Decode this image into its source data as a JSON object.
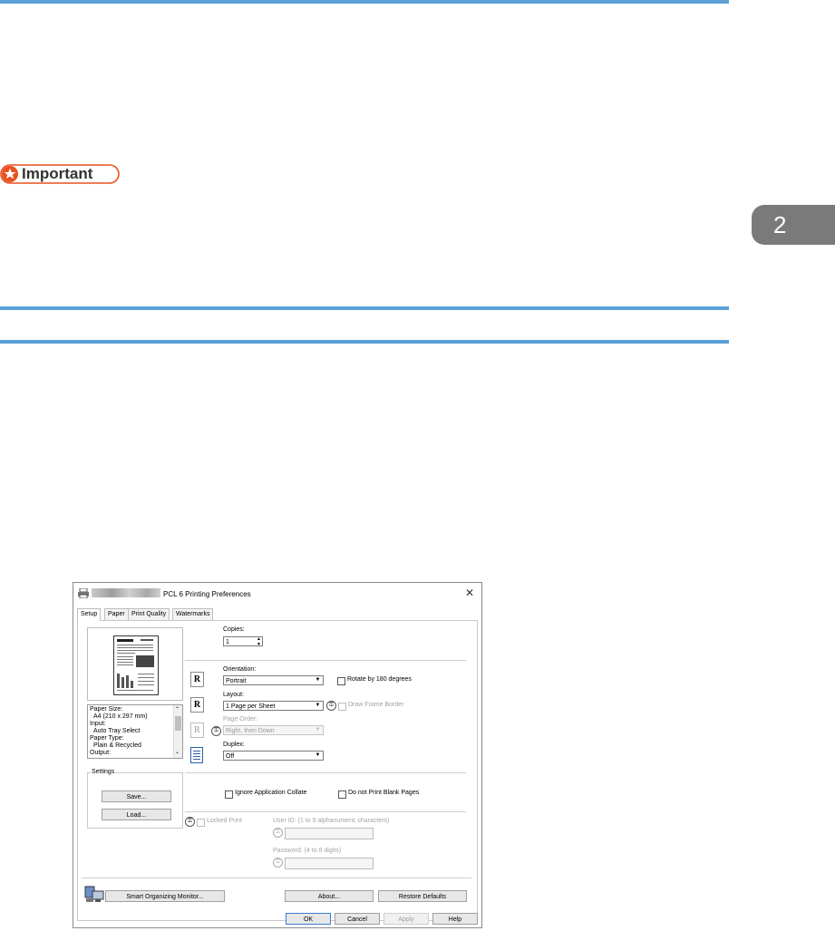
{
  "document": {
    "important_label": "Important",
    "chapter_number": "2"
  },
  "dialog": {
    "title": "PCL 6 Printing Preferences",
    "tabs": [
      "Setup",
      "Paper",
      "Print Quality",
      "Watermarks"
    ],
    "summary": {
      "items": [
        "Paper Size:",
        "A4 (210 x 297 mm)",
        "Input:",
        "Auto Tray Select",
        "Paper Type:",
        "Plain & Recycled",
        "Output:"
      ]
    },
    "settings": {
      "group_label": "Settings",
      "save_label": "Save...",
      "load_label": "Load..."
    },
    "copies": {
      "label": "Copies:",
      "value": "1"
    },
    "orientation": {
      "label": "Orientation:",
      "value": "Portrait",
      "rotate_label": "Rotate by 180 degrees"
    },
    "layout": {
      "label": "Layout:",
      "value": "1 Page per Sheet",
      "frame_label": "Draw Frame Border"
    },
    "page_order": {
      "label": "Page Order:",
      "value": "Right, then Down"
    },
    "duplex": {
      "label": "Duplex:",
      "value": "Off"
    },
    "collate_label": "Ignore Application Collate",
    "blank_pages_label": "Do not Print Blank Pages",
    "locked_print": {
      "label": "Locked Print",
      "user_id_label": "User ID: (1 to 9 alphanumeric characters)",
      "password_label": "Password: (4 to 8 digits)"
    },
    "bottom": {
      "monitor_label": "Smart Organizing Monitor...",
      "about_label": "About...",
      "restore_label": "Restore Defaults"
    },
    "footer": {
      "ok": "OK",
      "cancel": "Cancel",
      "apply": "Apply",
      "help": "Help"
    },
    "colors": {
      "accent_rule": "#5aa0d6",
      "important_orange": "#e8501e",
      "chapter_tab": "#7a7a7a"
    }
  }
}
